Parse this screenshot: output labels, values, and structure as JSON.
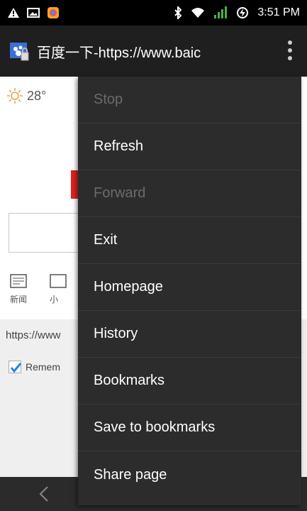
{
  "status_bar": {
    "time": "3:51 PM"
  },
  "app_bar": {
    "title": "百度一下-https://www.baic"
  },
  "webpage": {
    "weather": "28°",
    "news_label": "新闻",
    "news_label2": "小",
    "url": "https://www",
    "remember": "Remem"
  },
  "menu": {
    "items": [
      {
        "label": "Stop",
        "enabled": false
      },
      {
        "label": "Refresh",
        "enabled": true
      },
      {
        "label": "Forward",
        "enabled": false
      },
      {
        "label": "Exit",
        "enabled": true
      },
      {
        "label": "Homepage",
        "enabled": true
      },
      {
        "label": "History",
        "enabled": true
      },
      {
        "label": "Bookmarks",
        "enabled": true
      },
      {
        "label": "Save to bookmarks",
        "enabled": true
      },
      {
        "label": "Share page",
        "enabled": true
      }
    ]
  }
}
